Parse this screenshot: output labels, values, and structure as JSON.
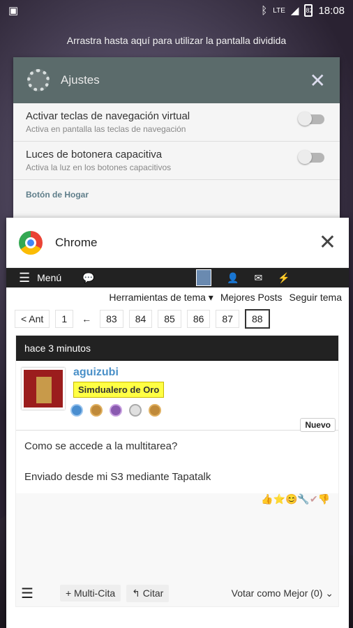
{
  "status": {
    "time": "18:08",
    "network": "LTE",
    "battery": "82"
  },
  "split_hint": "Arrastra hasta aquí para utilizar la pantalla dividida",
  "settings_card": {
    "title": "Ajustes",
    "rows": [
      {
        "title": "Activar teclas de navegación virtual",
        "sub": "Activa en pantalla las teclas de navegación"
      },
      {
        "title": "Luces de botonera capacitiva",
        "sub": "Activa la luz en los botones capacitivos"
      }
    ],
    "section": "Botón de Hogar"
  },
  "chrome_card": {
    "title": "Chrome",
    "menu_label": "Menú",
    "tool_links": [
      "Herramientas de tema ▾",
      "Mejores Posts",
      "Seguir tema"
    ],
    "pager": {
      "prev": "< Ant",
      "first": "1",
      "dots": "←",
      "pages": [
        "83",
        "84",
        "85",
        "86",
        "87",
        "88"
      ]
    },
    "post": {
      "time": "hace 3 minutos",
      "user": "aguizubi",
      "rank": "Simdualero de Oro",
      "badge": "Nuevo",
      "text1": "Como se accede a la multitarea?",
      "text2": "Enviado desde mi S3 mediante Tapatalk"
    },
    "footer": {
      "multi": "+ Multi-Cita",
      "quote": "↰ Citar",
      "vote": "Votar como Mejor (0) ⌄"
    }
  }
}
